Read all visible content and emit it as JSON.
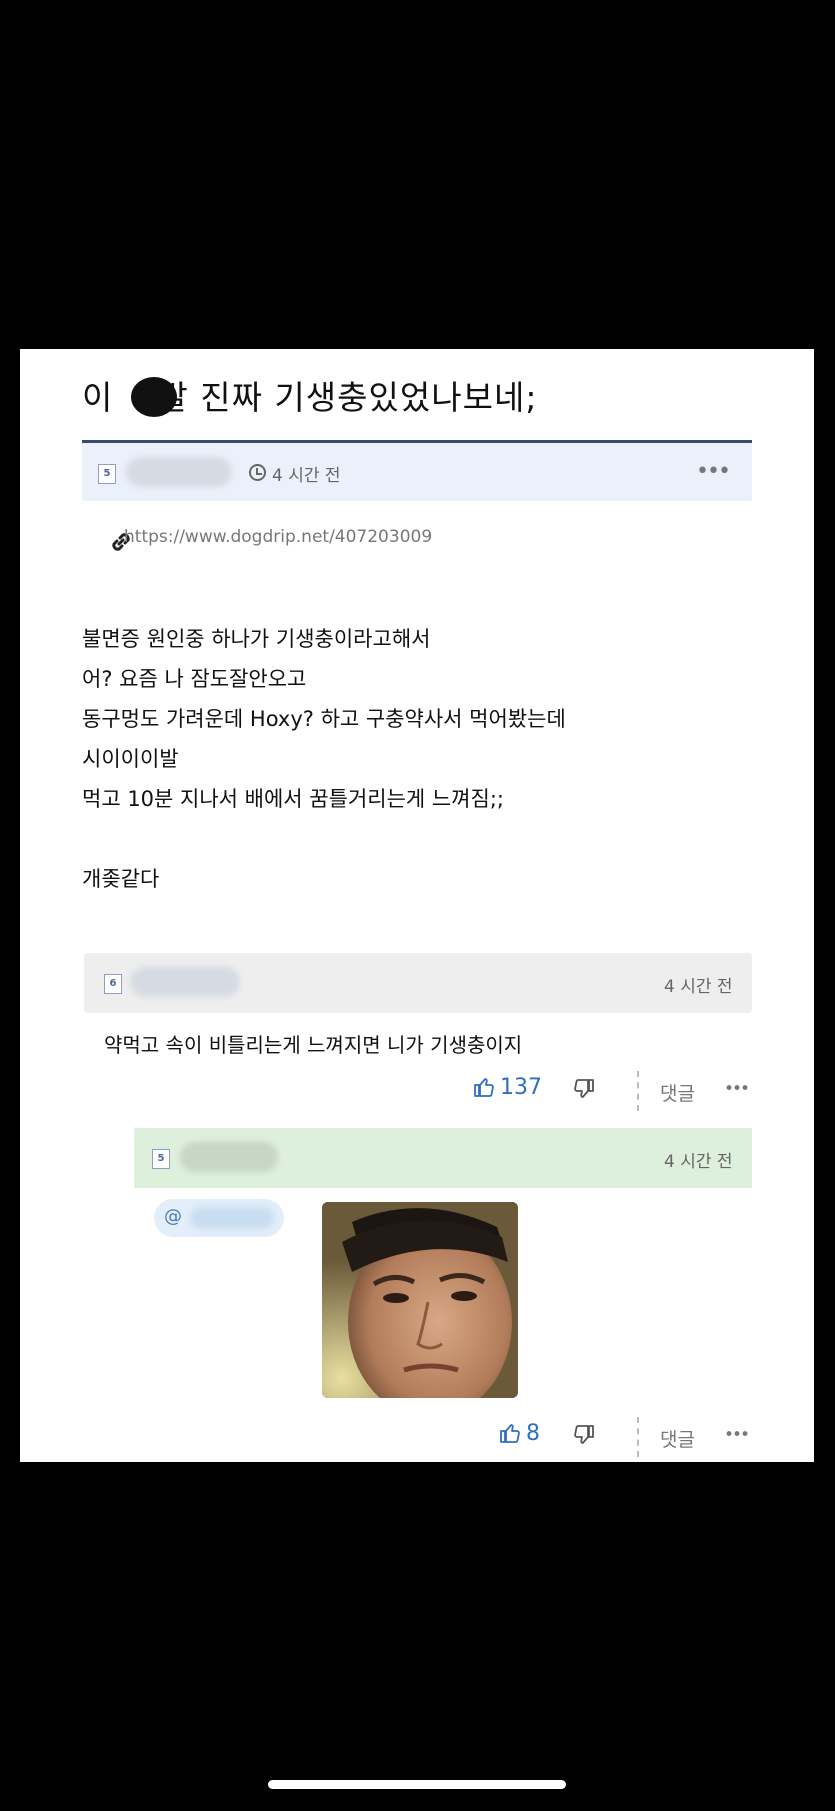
{
  "post": {
    "title_prefix": "이",
    "title_rest": "발 진짜 기생충있었나보네;",
    "level": "5",
    "time_label": "4 시간 전",
    "more_glyph": "•••",
    "url": "https://www.dogdrip.net/407203009",
    "body_lines": [
      "불면증 원인중 하나가 기생충이라고해서",
      "어? 요즘 나 잠도잘안오고",
      "동구멍도 가려운데 Hoxy? 하고 구충약사서 먹어봤는데",
      "시이이이발",
      "먹고 10분 지나서 배에서 꿈틀거리는게 느껴짐;;",
      "",
      "개좆같다"
    ]
  },
  "comments": [
    {
      "level": "6",
      "time": "4 시간 전",
      "text": "약먹고 속이 비틀리는게 느껴지면 니가 기생충이지",
      "likes": "137",
      "reply_label": "댓글",
      "more_glyph": "•••"
    },
    {
      "level": "5",
      "time": "4 시간 전",
      "mention_prefix": "@",
      "likes": "8",
      "reply_label": "댓글",
      "more_glyph": "•••"
    }
  ],
  "colors": {
    "header_bg": "#eaf1fb",
    "comment1_bg": "#eeeeee",
    "comment2_bg": "#ddf0db",
    "like_blue": "#2f6fc0",
    "title_rule": "#3a4a6b"
  },
  "icons": [
    "clock-icon",
    "link-icon",
    "more-icon",
    "thumbs-up-icon",
    "thumbs-down-icon",
    "avatar-face-image"
  ]
}
